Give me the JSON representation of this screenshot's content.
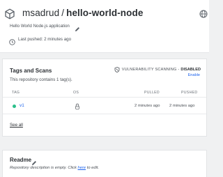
{
  "repo": {
    "owner": "msadrud",
    "separator": "/",
    "name": "hello-world-node",
    "description": "Hello World Node.js application",
    "last_pushed": "Last pushed: 2 minutes ago"
  },
  "tags_card": {
    "title": "Tags and Scans",
    "vuln_label": "VULNERABILITY SCANNING -",
    "vuln_status": "DISABLED",
    "enable_link": "Enable",
    "tag_count": "This repository contains 1 tag(s).",
    "columns": {
      "tag": "TAG",
      "os": "OS",
      "pulled": "PULLED",
      "pushed": "PUSHED"
    },
    "rows": [
      {
        "tag": "v1",
        "pulled": "2 minutes ago",
        "pushed": "2 minutes ago"
      }
    ],
    "see_all": "See all"
  },
  "readme_card": {
    "title": "Readme",
    "text_before": "Repository description is empty. Click ",
    "link": "here",
    "text_after": " to edit."
  },
  "colors": {
    "accent": "#1d63ed",
    "tag_status": "#2bbf8a",
    "page_background": "#f0f1f2"
  },
  "icons": [
    "repository-icon",
    "globe-icon",
    "pencil-icon",
    "clock-icon",
    "shield-icon",
    "linux-icon"
  ]
}
